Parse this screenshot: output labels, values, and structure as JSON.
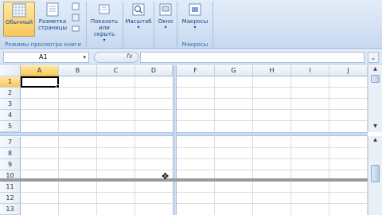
{
  "ribbon": {
    "views_group": {
      "normal_label": "Обычный",
      "page_layout_label": "Разметка страницы",
      "group_label": "Режимы просмотра книги"
    },
    "show_hide_label": "Показать или скрыть",
    "zoom_label": "Масштаб",
    "window_label": "Окно",
    "macros_button_label": "Макросы",
    "macros_group_label": "Макросы"
  },
  "formula_bar": {
    "name_box": "A1",
    "fx": "fx",
    "formula": ""
  },
  "sheet": {
    "columns_left": [
      "A",
      "B",
      "C",
      "D"
    ],
    "columns_right": [
      "F",
      "G",
      "H",
      "I",
      "J"
    ],
    "rows_top": [
      "1",
      "2",
      "3",
      "4",
      "5"
    ],
    "rows_bottom": [
      "7",
      "8",
      "9",
      "10",
      "11",
      "12",
      "13"
    ],
    "active_cell": "A1"
  }
}
